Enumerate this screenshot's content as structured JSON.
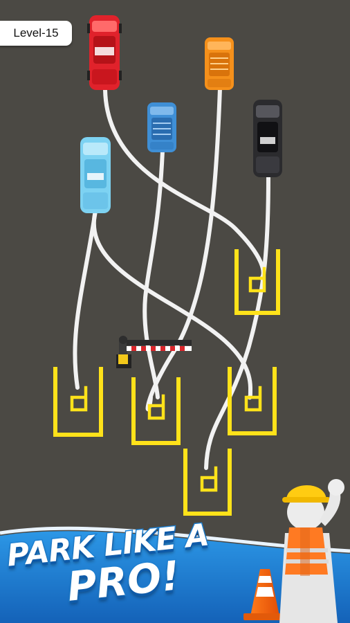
{
  "level": {
    "label": "Level-15"
  },
  "promo": {
    "line1": "Park like a",
    "line2": "Pro!"
  },
  "cars": [
    {
      "name": "red",
      "color": "#e0222b",
      "roof": "#b51218"
    },
    {
      "name": "orange",
      "color": "#f5901b",
      "roof": "#d9730b"
    },
    {
      "name": "blue",
      "color": "#3f8fd6",
      "roof": "#2a6db0"
    },
    {
      "name": "black",
      "color": "#2b2b2e",
      "roof": "#111114"
    },
    {
      "name": "light-blue",
      "color": "#7dd2f2",
      "roof": "#58b7e0"
    }
  ],
  "parking": {
    "line_color": "#ffe21a",
    "letter": "d"
  },
  "colors": {
    "asphalt": "#4b4944",
    "path": "#f2f2f2",
    "banner": "#1e7fd0"
  }
}
